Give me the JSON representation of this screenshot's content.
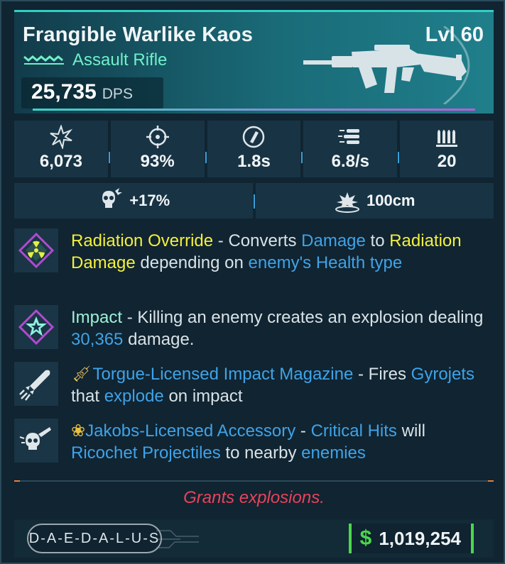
{
  "item": {
    "name": "Frangible Warlike Kaos",
    "level": "Lvl 60",
    "type": "Assault Rifle",
    "dps_value": "25,735",
    "dps_label": "DPS"
  },
  "stats": [
    {
      "icon": "damage-icon",
      "value": "6,073"
    },
    {
      "icon": "accuracy-icon",
      "value": "93%"
    },
    {
      "icon": "reload-icon",
      "value": "1.8s"
    },
    {
      "icon": "fire-rate-icon",
      "value": "6.8/s"
    },
    {
      "icon": "magazine-icon",
      "value": "20"
    }
  ],
  "substats": [
    {
      "icon": "skull-crit-icon",
      "value": "+17%"
    },
    {
      "icon": "explosion-radius-icon",
      "value": "100cm"
    }
  ],
  "perks": [
    {
      "icon": "radiation-icon",
      "parts": [
        "Radiation Override",
        " - Converts ",
        "Damage",
        " to ",
        "Radiation Damage",
        " depending on ",
        "enemy's Health type"
      ]
    },
    {
      "icon": "impact-star-icon",
      "parts": [
        "Impact",
        " - Killing an enemy creates an explosion dealing ",
        "30,365",
        " damage."
      ]
    },
    {
      "icon": "rocket-icon",
      "parts": [
        "Torgue-Licensed Impact Magazine",
        " - Fires ",
        "Gyrojets",
        " that ",
        "explode",
        " on impact"
      ]
    },
    {
      "icon": "skull-accessory-icon",
      "parts": [
        "Jakobs-Licensed Accessory",
        " - ",
        "Critical Hits",
        " will ",
        "Ricochet Projectiles",
        " to nearby ",
        "enemies"
      ]
    }
  ],
  "flavor": "Grants explosions.",
  "manufacturer": "D-A-E-D-A-L-U-S",
  "price": "1,019,254",
  "currency_symbol": "$",
  "colors": {
    "accent": "#2fd0c4",
    "keyword_yellow": "#f4f03a",
    "keyword_blue": "#3fa3e8",
    "flavor_red": "#e8435a",
    "price_green": "#4cd64c"
  }
}
